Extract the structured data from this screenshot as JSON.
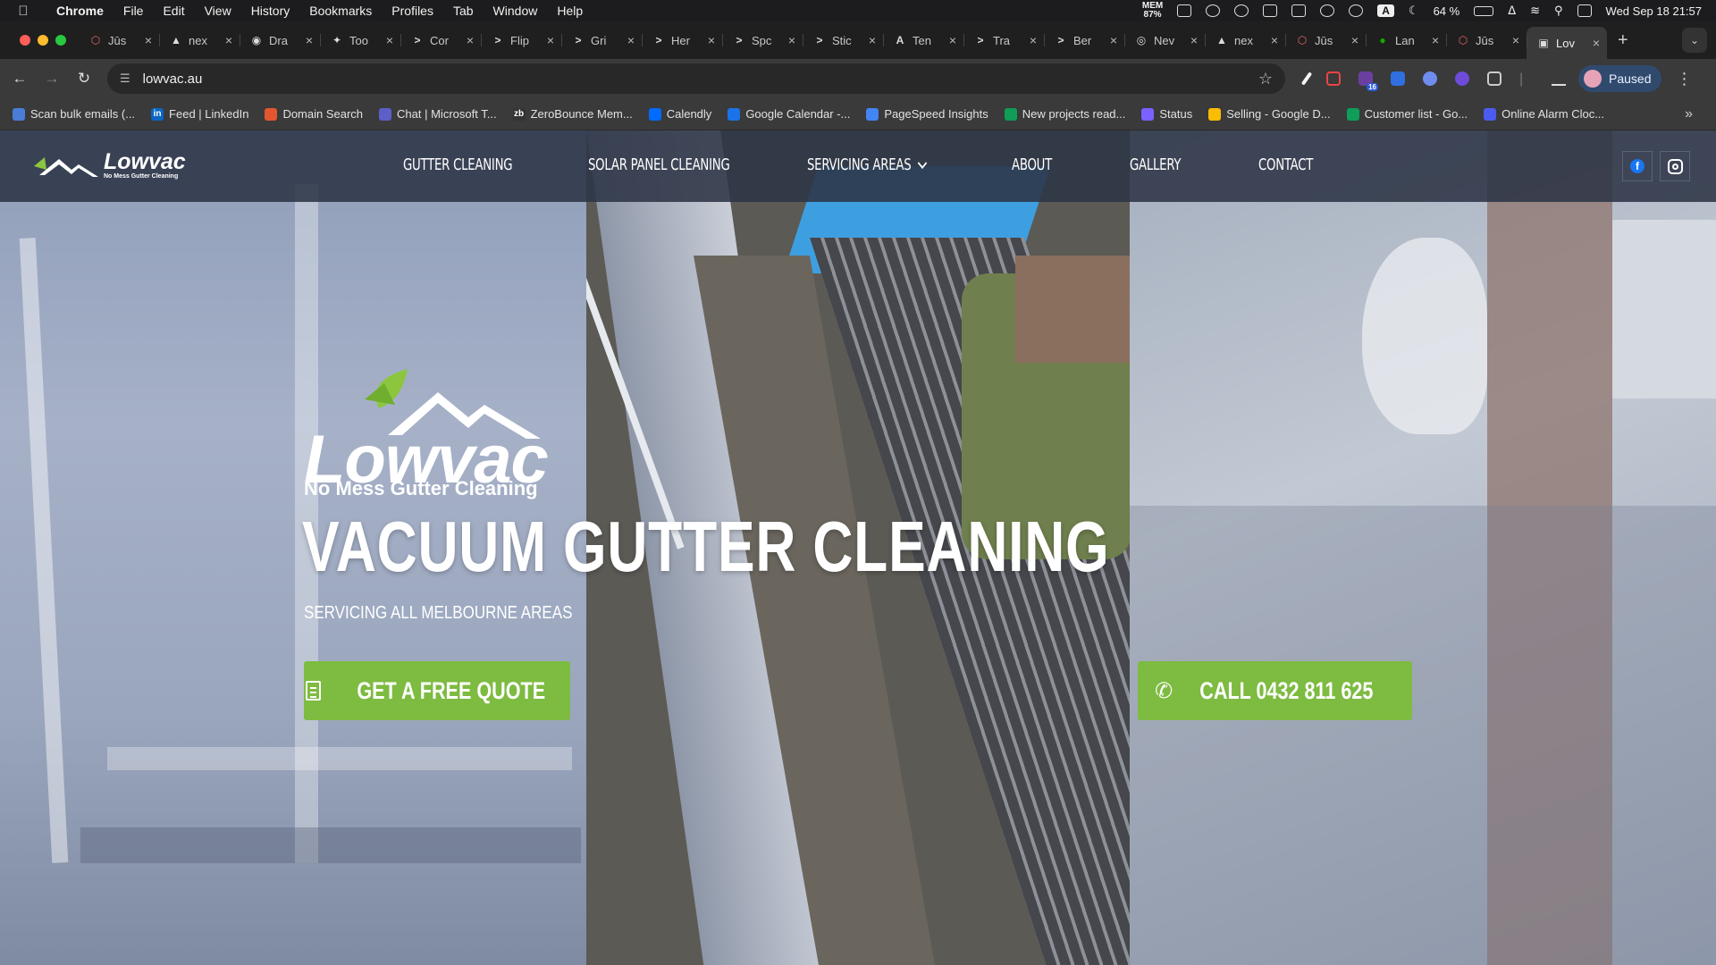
{
  "menubar": {
    "app": "Chrome",
    "items": [
      "File",
      "Edit",
      "View",
      "History",
      "Bookmarks",
      "Profiles",
      "Tab",
      "Window",
      "Help"
    ],
    "mem_label": "MEM",
    "mem_value": "87%",
    "battery": "64 %",
    "datetime": "Wed Sep 18  21:57",
    "input_badge": "A"
  },
  "tabs": [
    {
      "title": "Jūs",
      "icon": "hexagon-icon"
    },
    {
      "title": "nex",
      "icon": "triangle-icon"
    },
    {
      "title": "Dra",
      "icon": "github-icon"
    },
    {
      "title": "Too",
      "icon": "tool-icon"
    },
    {
      "title": "Cor",
      "icon": "prompt-icon"
    },
    {
      "title": "Flip",
      "icon": "prompt-icon"
    },
    {
      "title": "Gri",
      "icon": "prompt-icon"
    },
    {
      "title": "Her",
      "icon": "prompt-icon"
    },
    {
      "title": "Spc",
      "icon": "prompt-icon"
    },
    {
      "title": "Stic",
      "icon": "prompt-icon"
    },
    {
      "title": "Ten",
      "icon": "a-icon"
    },
    {
      "title": "Tra",
      "icon": "prompt-icon"
    },
    {
      "title": "Ber",
      "icon": "prompt-icon"
    },
    {
      "title": "Nev",
      "icon": "chrome-icon"
    },
    {
      "title": "nex",
      "icon": "triangle-icon"
    },
    {
      "title": "Jūs",
      "icon": "hexagon-icon"
    },
    {
      "title": "Lan",
      "icon": "up-icon"
    },
    {
      "title": "Jūs",
      "icon": "hexagon-icon"
    },
    {
      "title": "Lov",
      "icon": "image-icon",
      "active": true
    }
  ],
  "toolbar": {
    "url": "lowvac.au",
    "profile_status": "Paused",
    "ext_badge": "16"
  },
  "bookmarks": [
    {
      "label": "Scan bulk emails (...",
      "color": "#4a7dd8"
    },
    {
      "label": "Feed | LinkedIn",
      "color": "#0a66c2",
      "glyph": "in"
    },
    {
      "label": "Domain Search",
      "color": "#e4572e"
    },
    {
      "label": "Chat | Microsoft T...",
      "color": "#5b5fc7"
    },
    {
      "label": "ZeroBounce Mem...",
      "color": "#333333",
      "glyph": "zb"
    },
    {
      "label": "Calendly",
      "color": "#006bff"
    },
    {
      "label": "Google Calendar -...",
      "color": "#1a73e8"
    },
    {
      "label": "PageSpeed Insights",
      "color": "#4285f4"
    },
    {
      "label": "New projects read...",
      "color": "#0f9d58"
    },
    {
      "label": "Status",
      "color": "#7b61ff"
    },
    {
      "label": "Selling - Google D...",
      "color": "#fbbc04"
    },
    {
      "label": "Customer list - Go...",
      "color": "#0f9d58"
    },
    {
      "label": "Online Alarm Cloc...",
      "color": "#4a5cf0"
    }
  ],
  "site": {
    "brand_name": "Lowvac",
    "brand_tagline": "No Mess Gutter Cleaning",
    "nav": [
      {
        "label": "GUTTER CLEANING"
      },
      {
        "label": "SOLAR PANEL CLEANING"
      },
      {
        "label": "SERVICING AREAS"
      },
      {
        "label": "ABOUT"
      },
      {
        "label": "GALLERY"
      },
      {
        "label": "CONTACT"
      }
    ],
    "hero": {
      "title": "VACUUM GUTTER CLEANING",
      "subtitle": "SERVICING ALL MELBOURNE AREAS",
      "quote_button": "GET A FREE QUOTE",
      "call_button": "CALL 0432 811 625"
    },
    "colors": {
      "accent_green": "#7dbb41",
      "header_bg": "#2c3446"
    }
  }
}
